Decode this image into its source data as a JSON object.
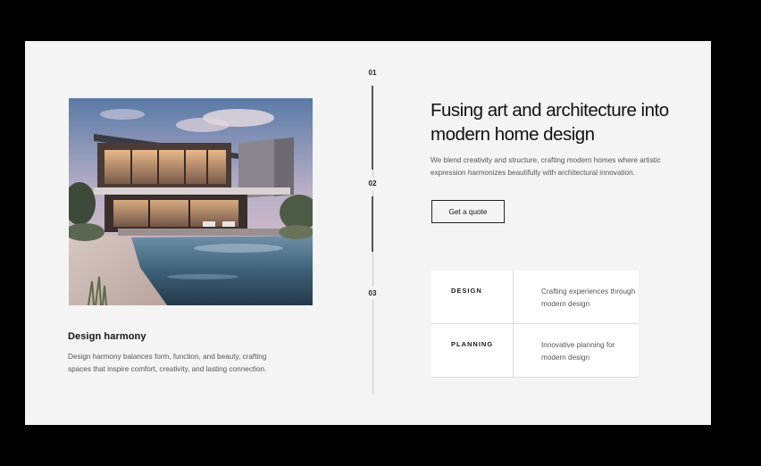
{
  "timeline": {
    "steps": [
      {
        "number": "01"
      },
      {
        "number": "02"
      },
      {
        "number": "03"
      }
    ]
  },
  "image": {
    "icon": "house-photo"
  },
  "caption": {
    "title": "Design harmony",
    "text": "Design harmony balances form, function, and beauty, crafting spaces that inspire comfort, creativity, and lasting connection."
  },
  "hero": {
    "headline": "Fusing art and architecture into modern home design",
    "lead": "We blend creativity and structure, crafting modern homes where artistic expression harmonizes beautifully with architectural innovation.",
    "cta_label": "Get a quote"
  },
  "services": [
    {
      "label": "DESIGN",
      "description": "Crafting experiences through modern design"
    },
    {
      "label": "PLANNING",
      "description": "Innovative planning for modern design"
    }
  ],
  "colors": {
    "page_background": "#000000",
    "panel_background": "#f4f4f4",
    "text_primary": "#111111",
    "text_secondary": "#555555"
  }
}
